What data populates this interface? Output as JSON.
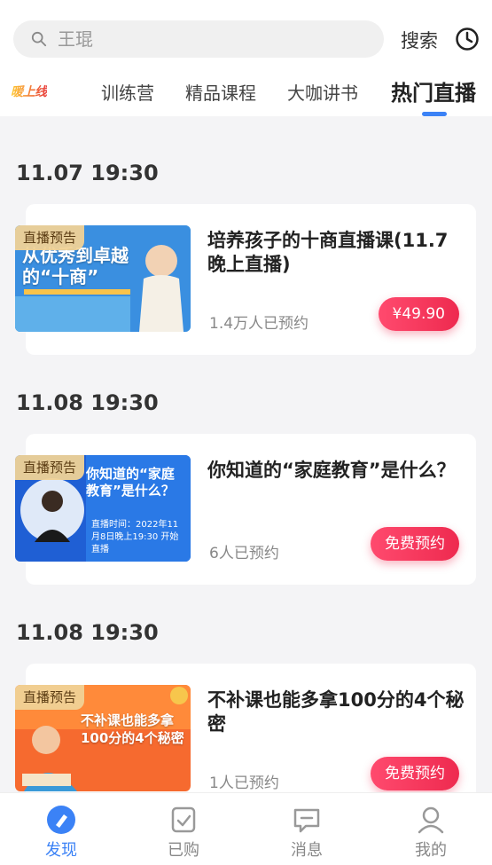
{
  "search": {
    "placeholder": "王琨",
    "button_label": "搜索"
  },
  "tabs": [
    {
      "label": "暖上线"
    },
    {
      "label": "训练营"
    },
    {
      "label": "精品课程"
    },
    {
      "label": "大咖讲书"
    },
    {
      "label": "热门直播",
      "active": true
    }
  ],
  "sessions": [
    {
      "date": "11.07 19:30",
      "badge": "直播预告",
      "thumb_text_main": "从优秀到卓越的“十商”",
      "title": "培养孩子的十商直播课(11.7晚上直播)",
      "subtitle": "1.4万人已预约",
      "button": "¥49.90"
    },
    {
      "date": "11.08 19:30",
      "badge": "直播预告",
      "thumb_text_main": "你知道的“家庭教育”是什么？",
      "thumb_text_sub": "直播时间：2022年11月8日晚上19:30 开始直播",
      "title": "你知道的“家庭教育”是什么？",
      "subtitle": "6人已预约",
      "button": "免费预约"
    },
    {
      "date": "11.08 19:30",
      "badge": "直播预告",
      "thumb_text_main": "不补课也能多拿100分的4个秘密",
      "title": "不补课也能多拿100分的4个秘密",
      "subtitle": "1人已预约",
      "button": "免费预约"
    }
  ],
  "tabbar": [
    {
      "label": "发现",
      "icon": "discover-icon",
      "active": true
    },
    {
      "label": "已购",
      "icon": "purchased-icon"
    },
    {
      "label": "消息",
      "icon": "message-icon"
    },
    {
      "label": "我的",
      "icon": "profile-icon"
    }
  ],
  "colors": {
    "accent": "#3b82f6",
    "price_button": "#ee2a4f"
  }
}
